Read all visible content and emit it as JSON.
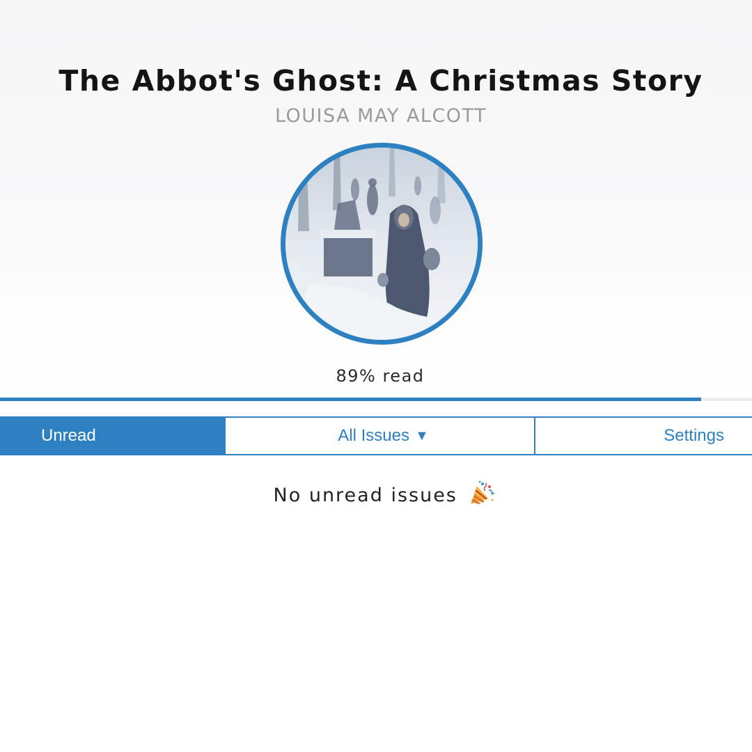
{
  "book": {
    "title": "The Abbot's Ghost: A Christmas Story",
    "author": "LOUISA MAY ALCOTT",
    "cover_icon": "book-cover-illustration-winter-street"
  },
  "progress": {
    "percent": 89,
    "label": "89% read"
  },
  "tabs": {
    "unread": "Unread",
    "all_issues": "All Issues",
    "all_issues_caret": "▼",
    "settings": "Settings"
  },
  "content": {
    "empty_message": "No unread issues",
    "empty_icon": "party-popper-icon"
  },
  "colors": {
    "accent": "#2d81c1",
    "text": "#141414",
    "muted": "#9a9a9a"
  }
}
